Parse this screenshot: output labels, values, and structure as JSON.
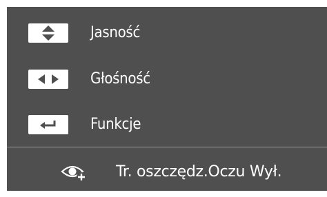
{
  "menu": {
    "items": [
      {
        "label": "Jasność",
        "key_icon": "up-down-arrows-icon"
      },
      {
        "label": "Głośność",
        "key_icon": "left-right-arrows-icon"
      },
      {
        "label": "Funkcje",
        "key_icon": "enter-return-icon"
      }
    ]
  },
  "footer": {
    "icon": "eye-saver-icon",
    "status_text": "Tr. oszczędz.Oczu Wył."
  },
  "colors": {
    "panel_background": "#4f4f4f",
    "text": "#ffffff",
    "divider": "#9a9a9a",
    "page_background": "#ffffff"
  }
}
